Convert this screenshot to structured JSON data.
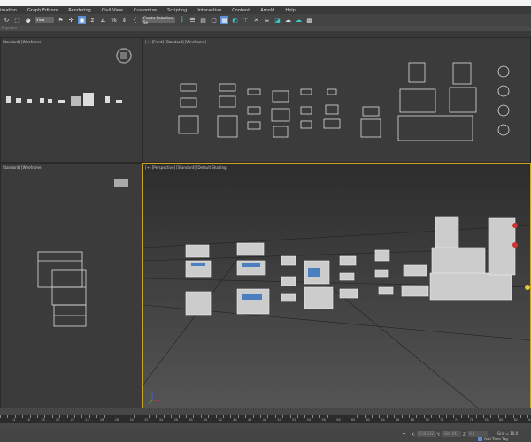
{
  "menu": [
    "imation",
    "Graph Editors",
    "Rendering",
    "Civil View",
    "Customize",
    "Scripting",
    "Interactive",
    "Content",
    "Arnold",
    "Help"
  ],
  "toolbar": {
    "view_dropdown": "View",
    "selection_set_dropdown": "Create Selection Se"
  },
  "ribbon": {
    "label": "Populate"
  },
  "viewports": {
    "top": "Standard] [Wireframe]",
    "front": "[+] [Front] [Standard] [Wireframe]",
    "left": "Standard] [Wireframe]",
    "perspective": "[+] [Perspective] [Standard] [Default Shading]"
  },
  "timeline": {
    "labels": [
      "14",
      "16",
      "18",
      "20",
      "22",
      "24",
      "26",
      "28",
      "30",
      "32",
      "34",
      "36",
      "38",
      "40",
      "42",
      "44",
      "46",
      "48",
      "50",
      "52",
      "54",
      "56",
      "58",
      "60",
      "62",
      "64",
      "66",
      "68",
      "70",
      "72",
      "74",
      "76",
      "78",
      "80",
      "82",
      "84"
    ]
  },
  "status": {
    "x_label": "X:",
    "x_value": "-154.332",
    "y_label": "Y:",
    "y_value": "-184.047",
    "z_label": "Z:",
    "z_value": "0.0",
    "grid": "Grid = 10.0",
    "add_time_tag": "Add Time Tag"
  }
}
